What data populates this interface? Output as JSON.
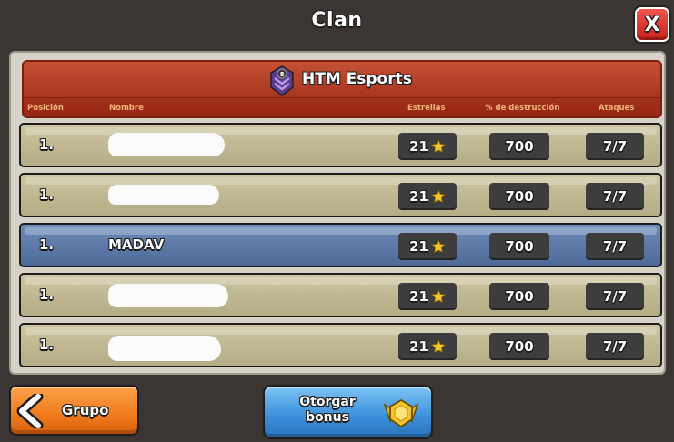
{
  "window": {
    "title": "Clan",
    "close_icon": "close-icon",
    "close_label": "X"
  },
  "clan": {
    "name": "HTM Esports",
    "badge_icon": "clan-badge-icon",
    "badge_level": "8"
  },
  "columns": {
    "position": "Posición",
    "name": "Nombre",
    "stars": "Estrellas",
    "destruction": "% de destrucción",
    "attacks": "Ataques"
  },
  "rows": [
    {
      "position": "1.",
      "name": "",
      "name_redacted": true,
      "stars": "21",
      "destruction": "700",
      "attacks": "7/7"
    },
    {
      "position": "1.",
      "name": "",
      "name_redacted": true,
      "stars": "21",
      "destruction": "700",
      "attacks": "7/7"
    },
    {
      "position": "1.",
      "name": "MADAV",
      "name_redacted": false,
      "highlighted": true,
      "stars": "21",
      "destruction": "700",
      "attacks": "7/7"
    },
    {
      "position": "1.",
      "name": "",
      "name_redacted": true,
      "stars": "21",
      "destruction": "700",
      "attacks": "7/7"
    },
    {
      "position": "1.",
      "name": "",
      "name_redacted": true,
      "stars": "21",
      "destruction": "700",
      "attacks": "7/7"
    }
  ],
  "footer": {
    "back_label": "Grupo",
    "back_icon": "chevron-left-icon",
    "bonus_label": "Otorgar bonus",
    "bonus_icon": "medal-icon"
  },
  "colors": {
    "banner": "#a8341f",
    "row": "#c0b993",
    "row_highlight": "#5a77a6",
    "pill": "#3d3d3d",
    "back_button": "#f07b1c",
    "bonus_button": "#3a8fd9"
  }
}
